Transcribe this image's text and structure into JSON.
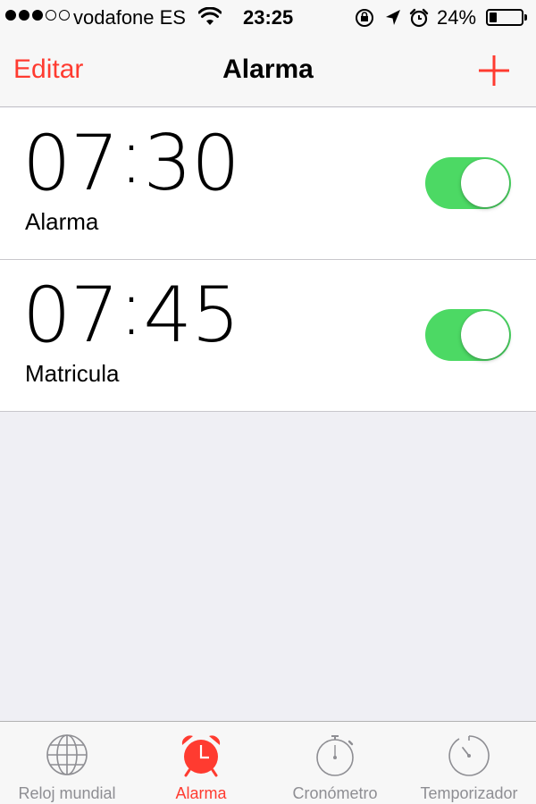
{
  "status_bar": {
    "carrier": "vodafone ES",
    "time": "23:25",
    "battery_percent": "24%",
    "battery_level": 0.24,
    "signal_bars": 3,
    "signal_total": 5
  },
  "nav": {
    "edit_label": "Editar",
    "title": "Alarma",
    "add_icon": "plus-icon"
  },
  "alarms": [
    {
      "hour": "07",
      "minute": "30",
      "label": "Alarma",
      "enabled": true
    },
    {
      "hour": "07",
      "minute": "45",
      "label": "Matricula",
      "enabled": true
    }
  ],
  "tabs": [
    {
      "label": "Reloj mundial",
      "icon": "globe-icon",
      "active": false
    },
    {
      "label": "Alarma",
      "icon": "alarm-clock-icon",
      "active": true
    },
    {
      "label": "Cronómetro",
      "icon": "stopwatch-icon",
      "active": false
    },
    {
      "label": "Temporizador",
      "icon": "timer-icon",
      "active": false
    }
  ],
  "colors": {
    "accent": "#ff3b30",
    "toggle_on": "#4cd964",
    "inactive_tab": "#8e8e93",
    "background": "#efeff4"
  }
}
